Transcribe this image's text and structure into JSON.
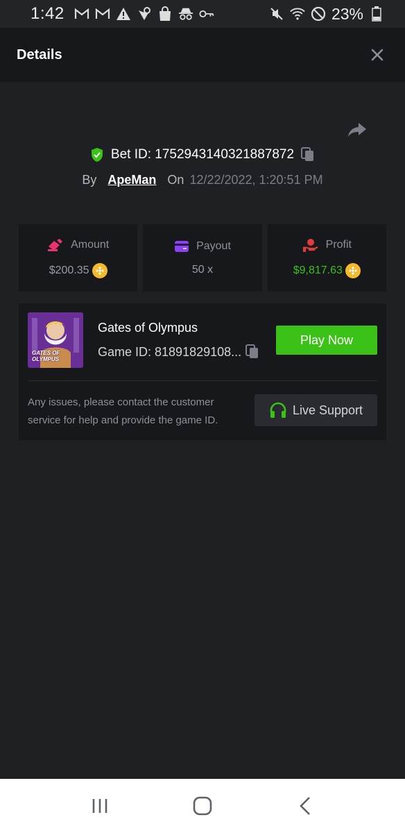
{
  "status_bar": {
    "time": "1:42",
    "battery": "23%",
    "icons_left": [
      "gmail-icon",
      "gmail-icon",
      "alert-icon",
      "vpn-icon",
      "bag-icon",
      "incognito-icon",
      "key-icon"
    ],
    "icons_right": [
      "mute-icon",
      "wifi-icon",
      "dnd-icon",
      "battery-icon"
    ]
  },
  "header": {
    "title": "Details"
  },
  "bet": {
    "id_text": "Bet ID: 1752943140321887872",
    "by_label": "By",
    "user": "ApeMan",
    "on_label": "On",
    "date": "12/22/2022, 1:20:51 PM"
  },
  "stats": [
    {
      "label": "Amount",
      "value": "$200.35",
      "icon": "amount-icon",
      "color": "#e8336e"
    },
    {
      "label": "Payout",
      "value": "50 x",
      "icon": "payout-icon",
      "color": "#8a43f0"
    },
    {
      "label": "Profit",
      "value": "$9,817.63",
      "icon": "profit-icon",
      "color": "#e23b3b"
    }
  ],
  "game": {
    "name": "Gates of Olympus",
    "id_text": "Game ID: 81891829108...",
    "thumb_label": "GATES OF OLYMPUS",
    "play_label": "Play Now",
    "support_text": "Any issues, please contact the customer service for help and provide the game ID.",
    "support_label": "Live Support"
  },
  "colors": {
    "accent_green": "#3bc117",
    "background": "#1f2024",
    "card": "#17181b"
  }
}
